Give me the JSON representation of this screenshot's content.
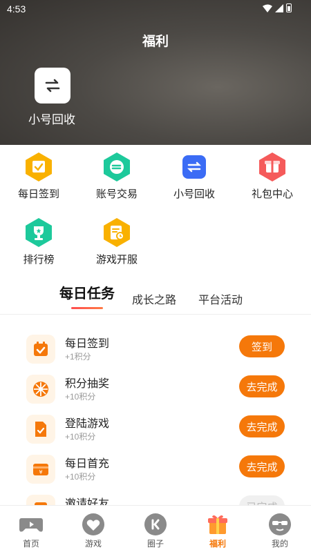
{
  "status": {
    "time": "4:53"
  },
  "header": {
    "title": "福利",
    "recycle_label": "小号回收"
  },
  "grid": [
    {
      "label": "每日签到",
      "icon": "calendar-check-icon",
      "color": "#f9b100"
    },
    {
      "label": "账号交易",
      "icon": "trade-arrows-icon",
      "color": "#1dc99b"
    },
    {
      "label": "小号回收",
      "icon": "recycle-arrows-icon",
      "color": "#3b6cf5"
    },
    {
      "label": "礼包中心",
      "icon": "gift-box-icon",
      "color": "#f55a5a"
    },
    {
      "label": "排行榜",
      "icon": "trophy-icon",
      "color": "#1dc99b"
    },
    {
      "label": "游戏开服",
      "icon": "server-clock-icon",
      "color": "#f9b100"
    }
  ],
  "tabs": [
    "每日任务",
    "成长之路",
    "平台活动"
  ],
  "tasks": [
    {
      "title": "每日签到",
      "sub": "+1积分",
      "button": "签到",
      "icon": "calendar-check-icon"
    },
    {
      "title": "积分抽奖",
      "sub": "+10积分",
      "button": "去完成",
      "icon": "wheel-icon"
    },
    {
      "title": "登陆游戏",
      "sub": "+10积分",
      "button": "去完成",
      "icon": "game-doc-icon"
    },
    {
      "title": "每日首充",
      "sub": "+10积分",
      "button": "去完成",
      "icon": "yen-card-icon"
    },
    {
      "title": "邀请好友",
      "sub": "",
      "button": "已完成",
      "icon": "invite-icon"
    }
  ],
  "nav": [
    {
      "label": "首页",
      "icon": "gamepad-icon"
    },
    {
      "label": "游戏",
      "icon": "heart-game-icon"
    },
    {
      "label": "圈子",
      "icon": "circle-chat-icon"
    },
    {
      "label": "福利",
      "icon": "gift-icon"
    },
    {
      "label": "我的",
      "icon": "sunglasses-avatar-icon"
    }
  ],
  "colors": {
    "accent": "#f5780a",
    "header_dark": "#3d3a37"
  }
}
